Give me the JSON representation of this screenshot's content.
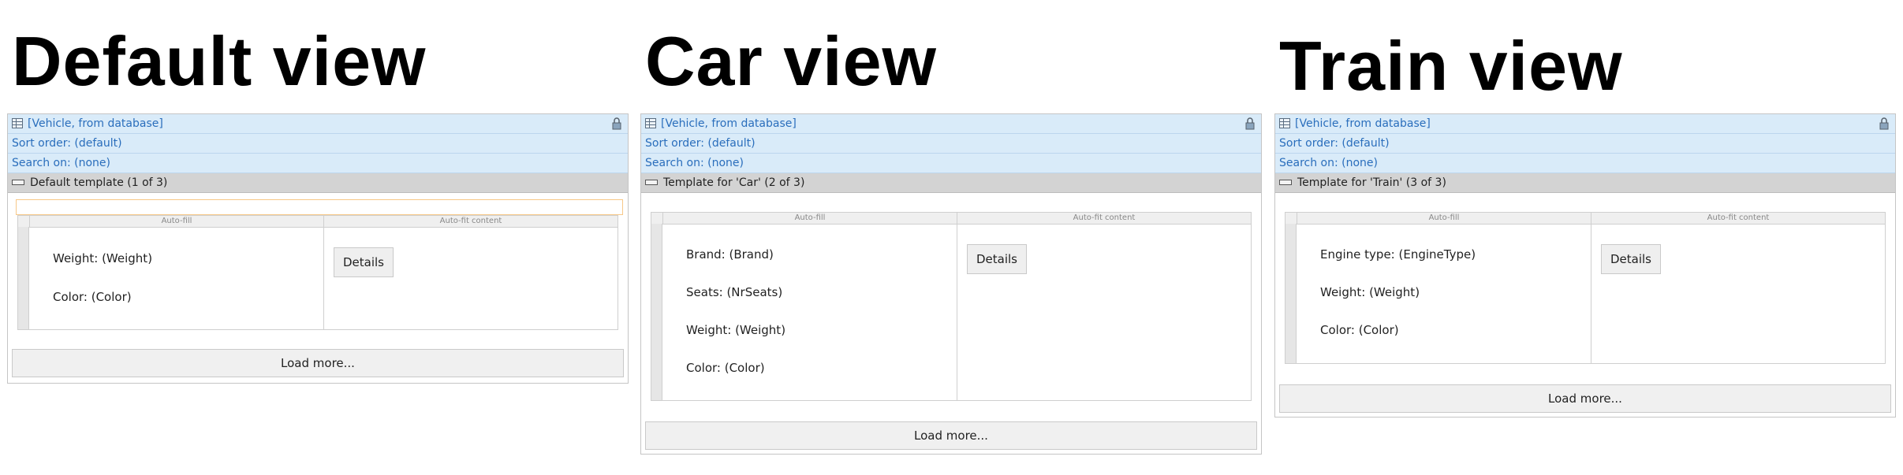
{
  "views": [
    {
      "title": "Default view",
      "source": "[Vehicle, from database]",
      "sort_order": "Sort order: (default)",
      "search_on": "Search on: (none)",
      "template": "Default template (1 of 3)",
      "columns": [
        "Auto-fill",
        "Auto-fit content"
      ],
      "fields": [
        "Weight: (Weight)",
        "Color: (Color)"
      ],
      "details_label": "Details",
      "load_more_label": "Load more..."
    },
    {
      "title": "Car view",
      "source": "[Vehicle, from database]",
      "sort_order": "Sort order: (default)",
      "search_on": "Search on: (none)",
      "template": "Template for 'Car' (2 of 3)",
      "columns": [
        "Auto-fill",
        "Auto-fit content"
      ],
      "fields": [
        "Brand: (Brand)",
        "Seats: (NrSeats)",
        "Weight: (Weight)",
        "Color: (Color)"
      ],
      "details_label": "Details",
      "load_more_label": "Load more..."
    },
    {
      "title": "Train view",
      "source": "[Vehicle, from database]",
      "sort_order": "Sort order: (default)",
      "search_on": "Search on: (none)",
      "template": "Template for 'Train' (3 of 3)",
      "columns": [
        "Auto-fill",
        "Auto-fit content"
      ],
      "fields": [
        "Engine type: (EngineType)",
        "Weight: (Weight)",
        "Color: (Color)"
      ],
      "details_label": "Details",
      "load_more_label": "Load more..."
    }
  ]
}
